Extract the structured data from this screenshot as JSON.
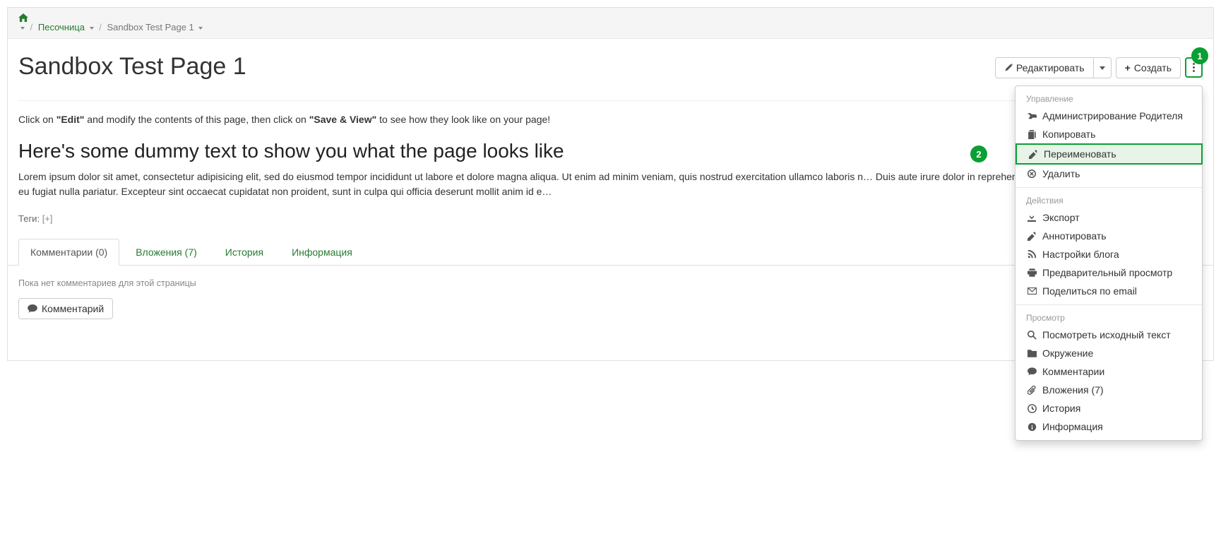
{
  "breadcrumb": {
    "home_label": "Home",
    "items": [
      {
        "label": "Песочница"
      },
      {
        "label": "Sandbox Test Page 1"
      }
    ]
  },
  "page": {
    "title": "Sandbox Test Page 1"
  },
  "actions": {
    "edit_label": "Редактировать",
    "create_label": "Создать"
  },
  "annotations": {
    "more_button": "1",
    "rename_item": "2"
  },
  "content": {
    "intro_pre": "Click on ",
    "intro_edit_bold": "\"Edit\"",
    "intro_mid": " and modify the contents of this page, then click on ",
    "intro_save_bold": "\"Save & View\"",
    "intro_post": " to see how they look like on your page!",
    "heading": "Here's some dummy text to show you what the page looks like",
    "lorem": "Lorem ipsum dolor sit amet, consectetur adipisicing elit, sed do eiusmod tempor incididunt ut labore et dolore magna aliqua. Ut enim ad minim veniam, quis nostrud exercitation ullamco laboris n… Duis aute irure dolor in reprehenderit in voluptate velit esse cillum dolore eu fugiat nulla pariatur. Excepteur sint occaecat cupidatat non proident, sunt in culpa qui officia deserunt mollit anim id e…"
  },
  "tags": {
    "label": "Теги:",
    "add": "[+]"
  },
  "tabs": {
    "items": [
      {
        "label": "Комментарии (0)",
        "active": true
      },
      {
        "label": "Вложения (7)",
        "active": false
      },
      {
        "label": "История",
        "active": false
      },
      {
        "label": "Информация",
        "active": false
      }
    ],
    "no_comments": "Пока нет комментариев для этой страницы",
    "comment_button": "Комментарий"
  },
  "dropdown": {
    "sections": {
      "manage": "Управление",
      "actions": "Действия",
      "view": "Просмотр"
    },
    "manage_items": {
      "admin_parent": "Администрирование Родителя",
      "copy": "Копировать",
      "rename": "Переименовать",
      "delete": "Удалить"
    },
    "action_items": {
      "export": "Экспорт",
      "annotate": "Аннотировать",
      "blog_settings": "Настройки блога",
      "preview": "Предварительный просмотр",
      "share_email": "Поделиться по email"
    },
    "view_items": {
      "view_source": "Посмотреть исходный текст",
      "environment": "Окружение",
      "comments": "Комментарии",
      "attachments": "Вложения (7)",
      "history": "История",
      "information": "Информация"
    }
  }
}
